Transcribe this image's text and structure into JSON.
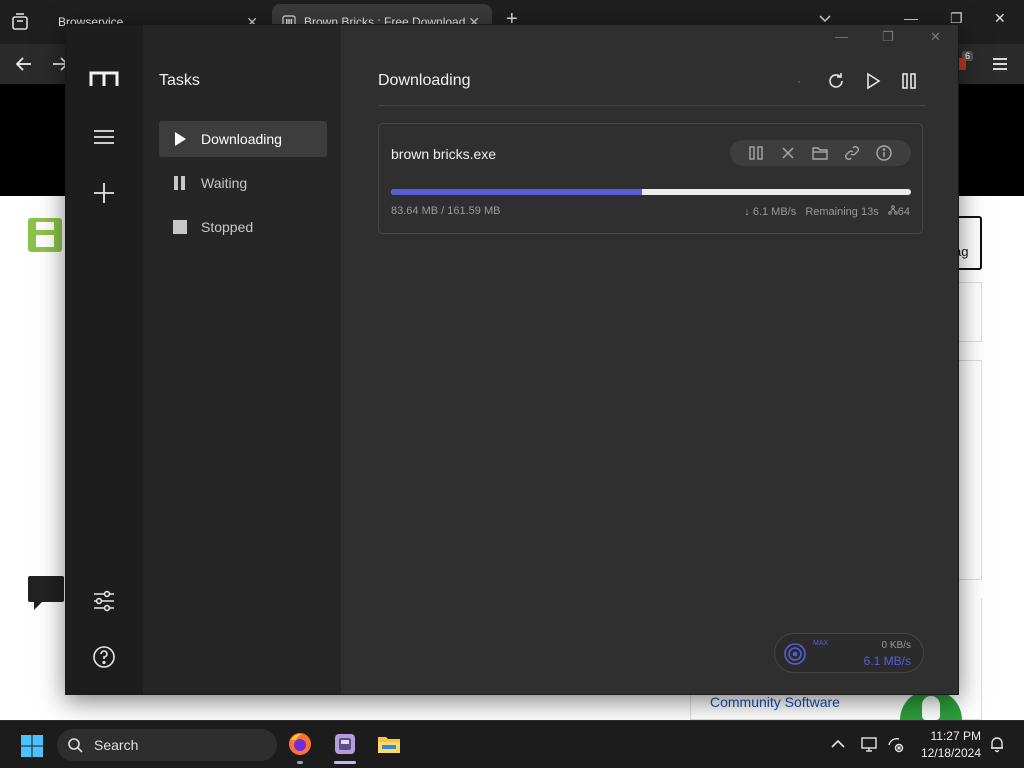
{
  "browser": {
    "tabs": [
      {
        "label": "Browservice"
      },
      {
        "label": "Brown Bricks : Free Download"
      }
    ],
    "new_tab": "+",
    "extension_badge": "6",
    "page": {
      "flag_button_label": "ag",
      "community_link": "Community Software"
    }
  },
  "app": {
    "tasks_title": "Tasks",
    "nav": [
      {
        "label": "Downloading",
        "icon": "play-icon",
        "active": true
      },
      {
        "label": "Waiting",
        "icon": "pause-icon",
        "active": false
      },
      {
        "label": "Stopped",
        "icon": "stop-icon",
        "active": false
      }
    ],
    "rail_icons": [
      "menu-icon",
      "add-icon",
      "settings-sliders-icon",
      "help-icon"
    ],
    "main": {
      "title": "Downloading",
      "header_actions": [
        "refresh-icon",
        "play-icon",
        "pause-icon"
      ]
    },
    "task": {
      "name": "brown bricks.exe",
      "actions": [
        "pause-icon",
        "close-icon",
        "folder-icon",
        "link-icon",
        "info-icon"
      ],
      "progress_fraction": 0.4818,
      "size_text": "83.64 MB / 161.59 MB",
      "speed": "↓ 6.1 MB/s",
      "remaining": "Remaining 13s",
      "connections": "64",
      "accent": "#5b5bd6"
    },
    "speedometer": {
      "max_label": "MAX",
      "upload": "0 KB/s",
      "download": "6.1 MB/s"
    }
  },
  "taskbar": {
    "search_label": "Search",
    "apps": [
      "firefox-icon",
      "download-manager-icon",
      "file-explorer-icon"
    ],
    "time": "11:27 PM",
    "date": "12/18/2024"
  }
}
